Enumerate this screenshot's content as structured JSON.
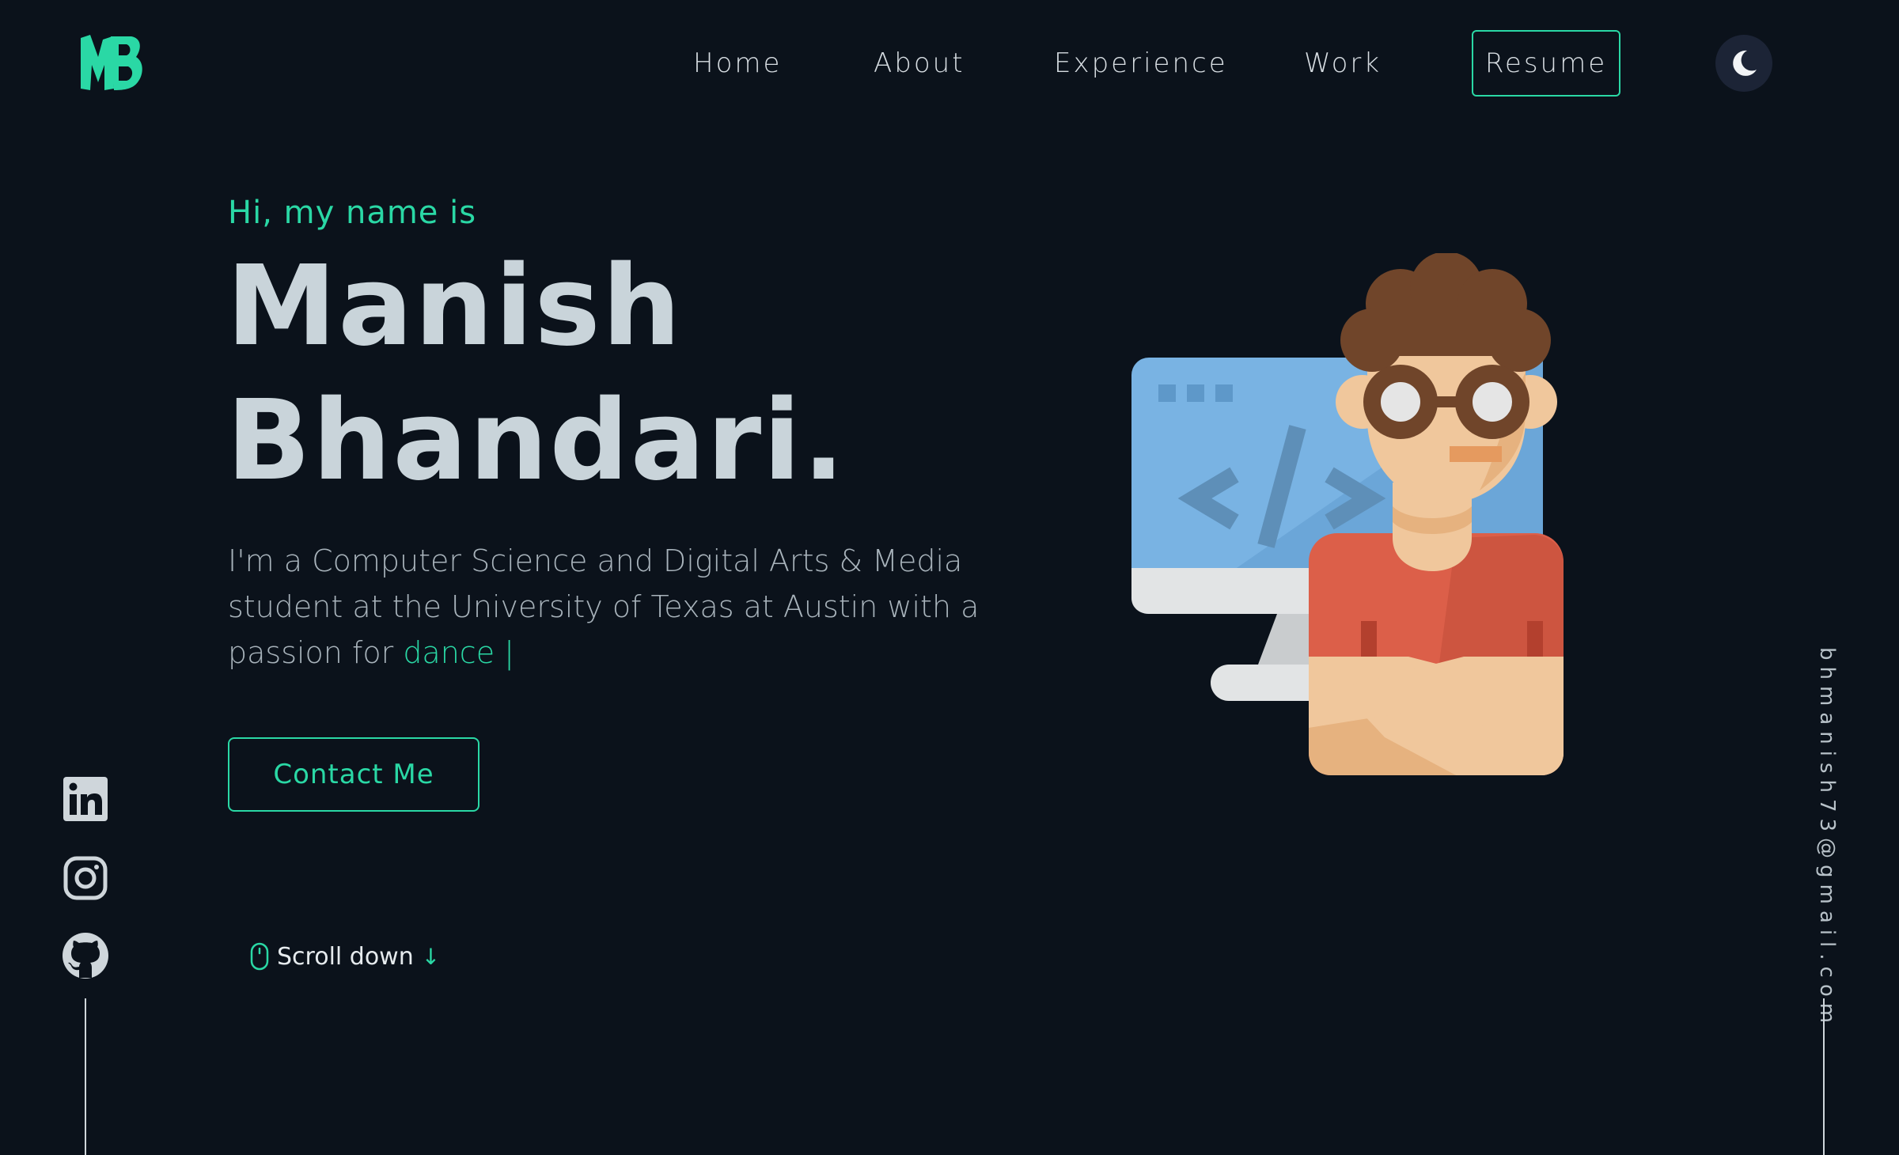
{
  "header": {
    "logo_text": "MB",
    "nav": [
      {
        "label": "Home"
      },
      {
        "label": "About"
      },
      {
        "label": "Experience"
      },
      {
        "label": "Work"
      }
    ],
    "resume_label": "Resume",
    "theme_icon": "moon-icon"
  },
  "hero": {
    "greeting": "Hi, my name is",
    "name_first": "Manish",
    "name_last": "Bhandari.",
    "bio_text": "I'm a Computer Science and Digital Arts & Media student at the University of Texas at Austin with a passion for ",
    "typed_word": "dance",
    "typed_cursor": "|",
    "contact_label": "Contact Me",
    "scroll_label": "Scroll down",
    "scroll_arrow": "↓"
  },
  "socials": [
    {
      "icon": "linkedin-icon"
    },
    {
      "icon": "instagram-icon"
    },
    {
      "icon": "github-icon"
    }
  ],
  "email": "bhmanish73@gmail.com",
  "colors": {
    "background": "#0b121b",
    "accent": "#2ad8a5",
    "text": "#c9d4da"
  }
}
